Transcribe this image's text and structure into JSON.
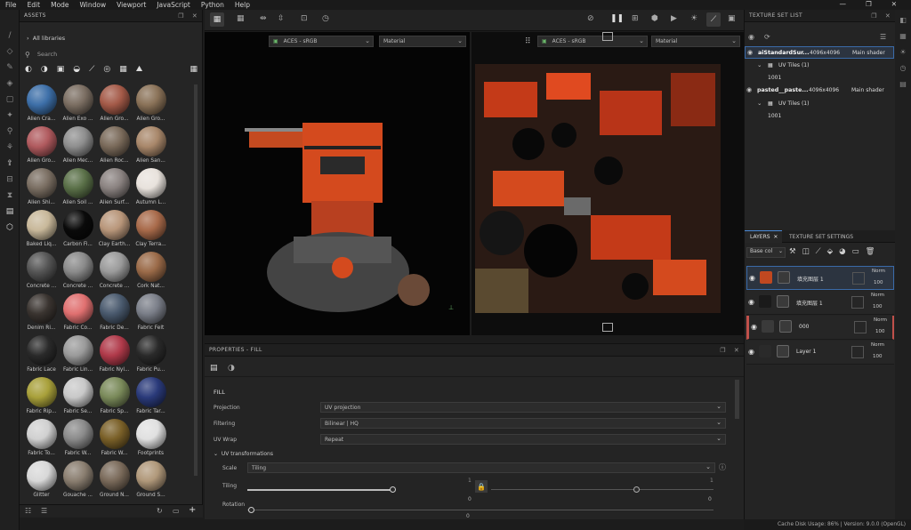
{
  "menu": [
    "File",
    "Edit",
    "Mode",
    "Window",
    "Viewport",
    "JavaScript",
    "Python",
    "Help"
  ],
  "window_controls": {
    "minimize": "—",
    "restore": "❐",
    "close": "✕"
  },
  "assets": {
    "title": "ASSETS",
    "library": "All libraries",
    "search_placeholder": "Search",
    "materials": [
      {
        "name": "Alien Cra...",
        "color": "#3d6fa8"
      },
      {
        "name": "Alien Exo ...",
        "color": "#7b6e62"
      },
      {
        "name": "Alien Gro...",
        "color": "#a45a48"
      },
      {
        "name": "Alien Gro...",
        "color": "#8a7258"
      },
      {
        "name": "Alien Gro...",
        "color": "#b05a5e"
      },
      {
        "name": "Alien Mec...",
        "color": "#8e8e8e"
      },
      {
        "name": "Alien Roc...",
        "color": "#7a6a5a"
      },
      {
        "name": "Alien San...",
        "color": "#a8876a"
      },
      {
        "name": "Alien Shi...",
        "color": "#7a6e62"
      },
      {
        "name": "Alien Soil ...",
        "color": "#5a7048"
      },
      {
        "name": "Alien Surf...",
        "color": "#8a8280"
      },
      {
        "name": "Autumn L...",
        "color": "#e8e2dc"
      },
      {
        "name": "Baked Liq...",
        "color": "#c8b89a"
      },
      {
        "name": "Carbon Fi...",
        "color": "#0a0a0a"
      },
      {
        "name": "Clay Earth...",
        "color": "#b8967a"
      },
      {
        "name": "Clay Terra...",
        "color": "#a86a4a"
      },
      {
        "name": "Concrete ...",
        "color": "#555555"
      },
      {
        "name": "Concrete ...",
        "color": "#8a8a8a"
      },
      {
        "name": "Concrete ...",
        "color": "#9a9a9a"
      },
      {
        "name": "Cork Nat...",
        "color": "#9a6a48"
      },
      {
        "name": "Denim Ri...",
        "color": "#3a3430"
      },
      {
        "name": "Fabric Co...",
        "color": "#e07070"
      },
      {
        "name": "Fabric De...",
        "color": "#4a5a6e"
      },
      {
        "name": "Fabric Felt",
        "color": "#7a7e88"
      },
      {
        "name": "Fabric Lace",
        "color": "#2a2a2a"
      },
      {
        "name": "Fabric Lin...",
        "color": "#9a9a9a"
      },
      {
        "name": "Fabric Nyl...",
        "color": "#b03a4a"
      },
      {
        "name": "Fabric Pu...",
        "color": "#2a2a2a"
      },
      {
        "name": "Fabric Rip...",
        "color": "#a8a03a"
      },
      {
        "name": "Fabric Se...",
        "color": "#c8c8c8"
      },
      {
        "name": "Fabric Sp...",
        "color": "#7a8a5a"
      },
      {
        "name": "Fabric Tar...",
        "color": "#2a3a7a"
      },
      {
        "name": "Fabric To...",
        "color": "#d0d0d0"
      },
      {
        "name": "Fabric W...",
        "color": "#8a8a8a"
      },
      {
        "name": "Fabric W...",
        "color": "#7a6028"
      },
      {
        "name": "Footprints",
        "color": "#e0e0e0"
      },
      {
        "name": "Glitter",
        "color": "#d8d8d8"
      },
      {
        "name": "Gouache ...",
        "color": "#8a7e70"
      },
      {
        "name": "Ground N...",
        "color": "#7a6a5a"
      },
      {
        "name": "Ground S...",
        "color": "#b0987a"
      }
    ]
  },
  "viewport": {
    "left": {
      "colorspace": "ACES - sRGB",
      "channel": "Material"
    },
    "right": {
      "colorspace": "ACES - sRGB",
      "channel": "Material"
    }
  },
  "properties": {
    "title": "PROPERTIES - FILL",
    "section": "FILL",
    "projection_label": "Projection",
    "projection_value": "UV projection",
    "filtering_label": "Filtering",
    "filtering_value": "Bilinear | HQ",
    "uvwrap_label": "UV Wrap",
    "uvwrap_value": "Repeat",
    "uvtrans_label": "UV transformations",
    "scale_label": "Scale",
    "scale_value": "Tiling",
    "tiling_label": "Tiling",
    "tiling_a": "1",
    "tiling_b": "1",
    "tiling_a_bottom": "0",
    "tiling_b_bottom": "0",
    "rotation_label": "Rotation",
    "rotation_bottom": "0"
  },
  "texture_set": {
    "title": "TEXTURE SET LIST",
    "sets": [
      {
        "name": "aiStandardSur...",
        "res": "4096x4096",
        "shader": "Main shader",
        "tiles_label": "UV Tiles (1)",
        "tile": "1001"
      },
      {
        "name": "pasted__paste...",
        "res": "4096x4096",
        "shader": "Main shader",
        "tiles_label": "UV Tiles (1)",
        "tile": "1001"
      }
    ]
  },
  "layers": {
    "tab1": "LAYERS",
    "tab2": "TEXTURE SET SETTINGS",
    "channel": "Base col",
    "items": [
      {
        "name": "填充图层 1",
        "blend": "Norm",
        "opacity": "100",
        "thumb": "#c04820"
      },
      {
        "name": "填充图层 1",
        "blend": "Norm",
        "opacity": "100",
        "thumb": "#1a1a1a"
      },
      {
        "name": "000",
        "blend": "Norm",
        "opacity": "100",
        "thumb": "#3a3a3a"
      },
      {
        "name": "Layer 1",
        "blend": "Norm",
        "opacity": "100",
        "thumb": "#2a2a2a"
      }
    ]
  },
  "status": {
    "text": "Cache Disk Usage:   86%  |  Version: 9.0.0 (OpenGL)"
  }
}
